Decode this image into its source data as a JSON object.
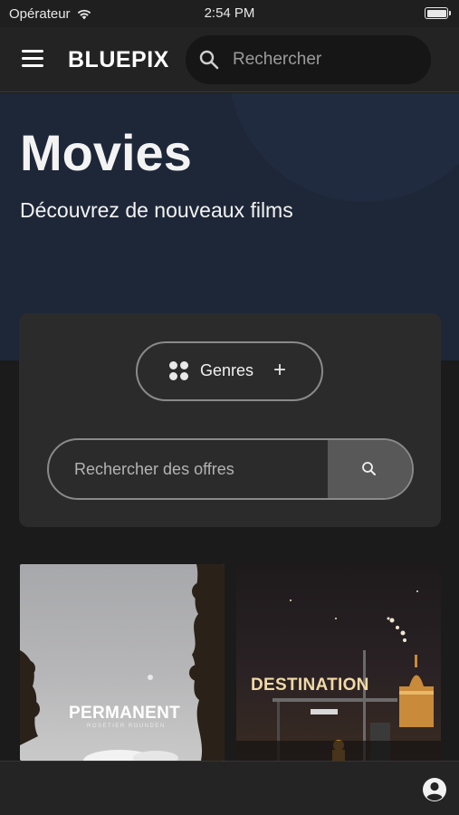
{
  "status_bar": {
    "carrier": "Opérateur",
    "time": "2:54 PM"
  },
  "header": {
    "brand": "BLUEPIX",
    "search_placeholder": "Rechercher"
  },
  "hero": {
    "title": "Movies",
    "subtitle": "Découvrez de nouveaux films"
  },
  "filters": {
    "genres_label": "Genres",
    "offers_placeholder": "Rechercher des offres"
  },
  "movies": [
    {
      "title": "PERMANENT",
      "tagline": "ROSETIER ROUNDEN"
    },
    {
      "title": "DESTINATION"
    }
  ],
  "colors": {
    "hero_bg": "#1e2738",
    "panel_bg": "#2b2b2c",
    "app_bg": "#1b1b1c"
  },
  "icons": [
    "menu-icon",
    "search-icon",
    "grid-icon",
    "plus-icon",
    "account-icon",
    "wifi-icon"
  ]
}
